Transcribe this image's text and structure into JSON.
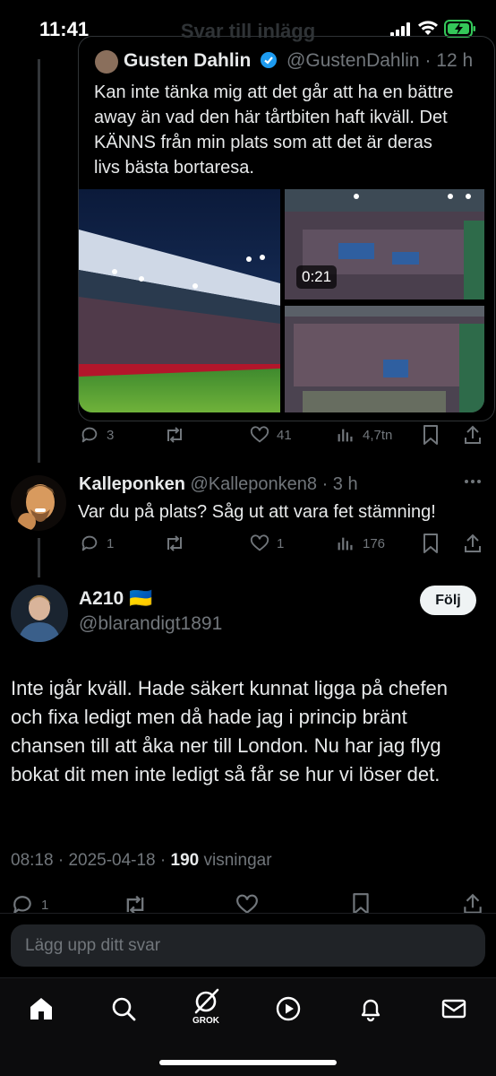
{
  "status_bar": {
    "time": "11:41",
    "header_title": "Svar till inlägg"
  },
  "quoted_tweet": {
    "author_name": "Gusten Dahlin",
    "handle": "@GustenDahlin",
    "time_ago": "12 h",
    "text": "Kan inte tänka mig att det går att ha en bättre away än vad den här tårtbiten haft ikväll. Det KÄNNS från min plats som att det är deras livs bästa bortaresa.",
    "video_duration": "0:21",
    "stats": {
      "replies": "3",
      "retweets": "",
      "likes": "41",
      "views": "4,7tn"
    }
  },
  "reply": {
    "author_name": "Kalleponken",
    "handle": "@Kalleponken8",
    "separator": "·",
    "time_ago": "3 h",
    "text": "Var du på plats? Såg ut att vara fet stämning!",
    "stats": {
      "replies": "1",
      "retweets": "",
      "likes": "1",
      "views": "176"
    }
  },
  "main_post": {
    "author_name": "A210",
    "flag": "🇺🇦",
    "handle": "@blarandigt1891",
    "follow_label": "Följ",
    "text": "Inte igår kväll. Hade säkert kunnat ligga på chefen och fixa ledigt men då hade jag i princip bränt chansen till att åka ner till London. Nu har jag flyg bokat dit men inte ledigt så får se hur vi löser det.",
    "time": "08:18",
    "date": "2025-04-18",
    "views_count": "190",
    "views_label": "visningar",
    "stats": {
      "replies": "1"
    }
  },
  "composer": {
    "placeholder": "Lägg upp ditt svar"
  },
  "nav": {
    "grok_label": "GROK"
  },
  "colors": {
    "accent": "#1d9bf0",
    "muted": "#71767b",
    "verified": "#1d9bf0",
    "battery": "#34c759"
  }
}
